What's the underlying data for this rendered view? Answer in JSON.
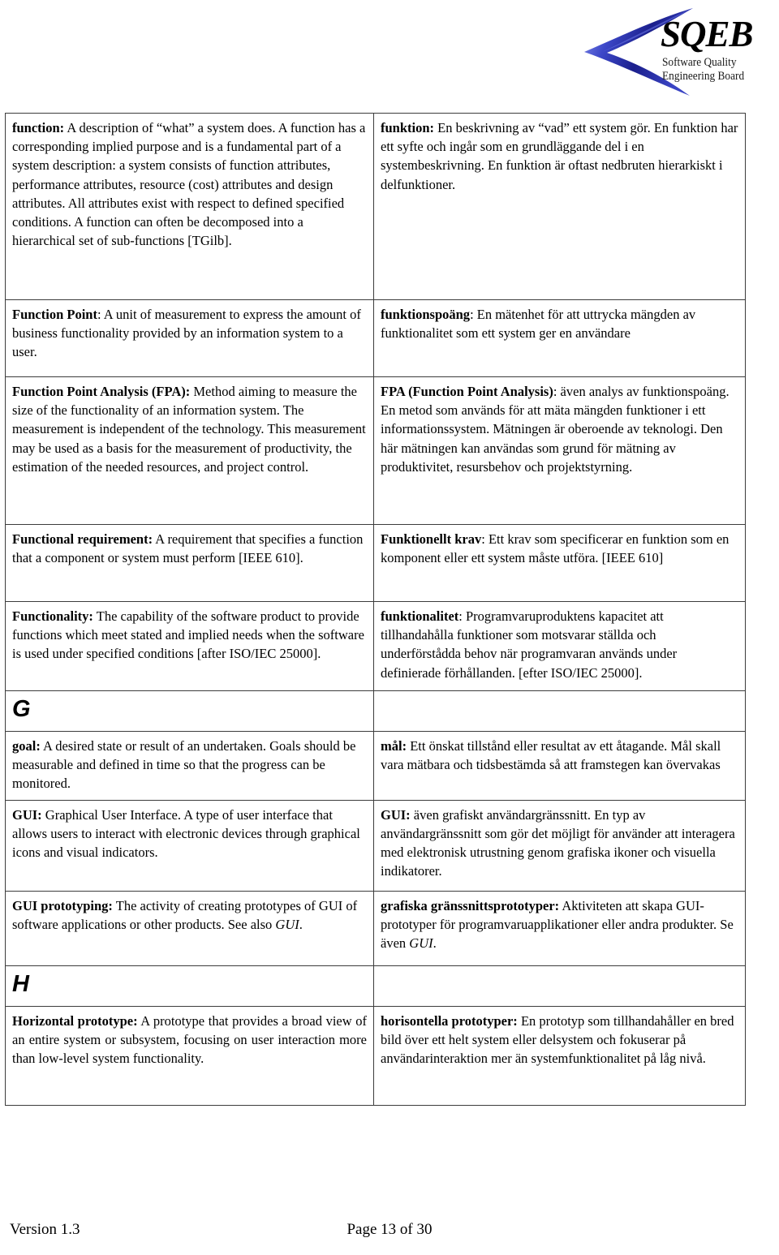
{
  "header": {
    "logo": {
      "wordmark": "SQEB",
      "tagline_line1": "Software Quality",
      "tagline_line2": "Engineering Board",
      "swoosh_color_light": "#6b79e8",
      "swoosh_color_dark": "#1b1f8c"
    }
  },
  "glossary": {
    "rows": [
      {
        "type": "entry",
        "en": {
          "term": "function:",
          "body": " A description of “what” a system does. A function has a corresponding implied purpose and is a fundamental part of a system description: a system consists of function attributes, performance attributes, resource (cost) attributes and design attributes. All attributes exist with respect to defined specified conditions.  A function can often be decomposed into a hierarchical set of sub-functions [TGilb]."
        },
        "sv": {
          "term": "funktion:",
          "body": " En beskrivning av “vad” ett system gör. En funktion har ett syfte och ingår som en grundläggande del i en systembeskrivning. En funktion är oftast nedbruten hierarkiskt i delfunktioner."
        }
      },
      {
        "type": "entry",
        "en": {
          "term": "Function Point",
          "body": ": A unit of measurement to express the amount of business functionality provided by an information system to a user."
        },
        "sv": {
          "term": "funktionspoäng",
          "body": ": En mätenhet för att uttrycka mängden av funktionalitet som ett system ger en användare"
        }
      },
      {
        "type": "entry",
        "en": {
          "term": "Function Point Analysis (FPA):",
          "body": " Method aiming to measure the size of the functionality of an information system. The measurement is independent of the technology. This measurement may be used as a basis for the measurement of productivity, the estimation of the needed resources, and project control."
        },
        "sv": {
          "term": "FPA (Function Point Analysis)",
          "body": ": även analys av funktionspoäng. En metod som används för att mäta mängden funktioner i ett informationssystem. Mätningen är oberoende av teknologi. Den här mätningen kan användas som grund för mätning av produktivitet, resursbehov och projektstyrning."
        }
      },
      {
        "type": "entry",
        "en": {
          "term": "Functional requirement:",
          "body": " A requirement that specifies a function that a component or system must perform [IEEE 610]."
        },
        "sv": {
          "term": "Funktionellt krav",
          "body": ": Ett krav som specificerar en funktion som en komponent eller ett system måste utföra. [IEEE 610]"
        }
      },
      {
        "type": "entry",
        "en": {
          "term": "Functionality:",
          "body": " The capability of the software product to provide functions which meet stated and implied needs when the software is used under specified conditions [after ISO/IEC 25000]."
        },
        "sv": {
          "term": "funktionalitet",
          "body": ": Programvaruproduktens kapacitet att tillhandahålla funktioner som motsvarar ställda och underförstådda behov när programvaran används under definierade förhållanden. [efter ISO/IEC 25000]."
        }
      },
      {
        "type": "letter",
        "letter": "G"
      },
      {
        "type": "entry",
        "en": {
          "term": "goal:",
          "body": " A desired state or result of an undertaken. Goals should be measurable and defined in time so that the progress can be monitored."
        },
        "sv": {
          "term": "mål:",
          "body": " Ett önskat tillstånd eller resultat av ett åtagande. Mål skall vara mätbara och tidsbestämda så att framstegen kan övervakas"
        }
      },
      {
        "type": "entry",
        "en": {
          "term": "GUI:",
          "body": " Graphical User Interface. A type of user interface that allows users to interact with electronic devices through graphical icons and visual indicators."
        },
        "sv": {
          "term": "GUI:",
          "body": " även grafiskt användargränssnitt. En typ av användargränssnitt som gör det möjligt för använder att interagera med elektronisk utrustning genom grafiska ikoner och visuella indikatorer."
        }
      },
      {
        "type": "entry",
        "en": {
          "term": "GUI prototyping:",
          "body": "  The activity of creating prototypes of GUI of software applications or other products. See also ",
          "italic_tail": "GUI",
          "tail": "."
        },
        "sv": {
          "term": "grafiska gränssnittsprototyper:",
          "body": " Aktiviteten att skapa GUI-prototyper för programvaruapplikationer eller andra produkter. Se även ",
          "italic_tail": "GUI",
          "tail": "."
        }
      },
      {
        "type": "letter",
        "letter": "H"
      },
      {
        "type": "entry",
        "justify_en": true,
        "en": {
          "term": "Horizontal prototype:",
          "body": " A prototype that provides a broad view of an entire system or subsystem, focusing on user interaction more than low-level system functionality."
        },
        "sv": {
          "term": "horisontella prototyper:",
          "body": " En prototyp som tillhandahåller en bred bild över ett helt system eller delsystem och fokuserar på användarinteraktion mer än systemfunktionalitet på låg nivå."
        }
      }
    ]
  },
  "footer": {
    "version": "Version 1.3",
    "page": "Page 13 of 30"
  }
}
